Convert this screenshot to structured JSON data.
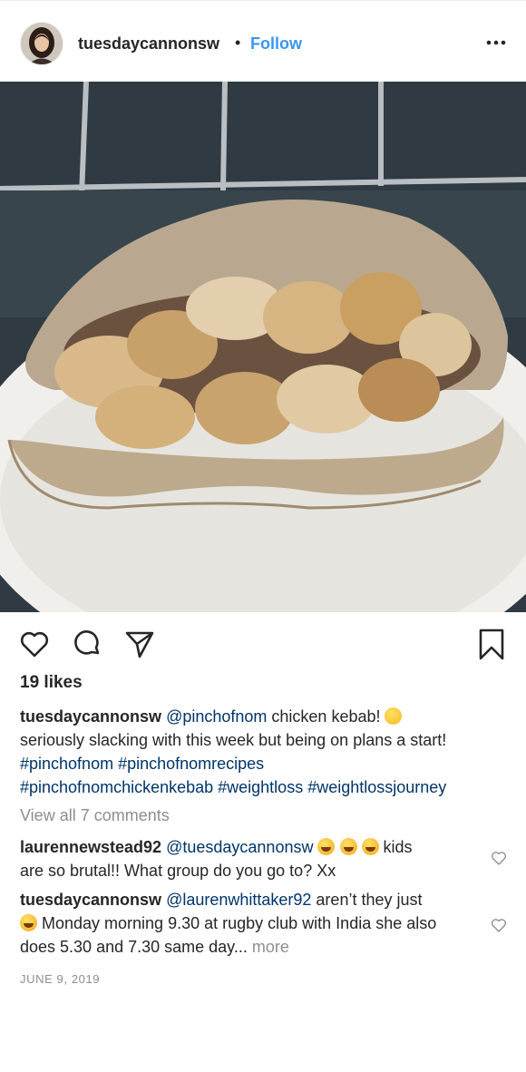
{
  "header": {
    "username": "tuesdaycannonsw",
    "separator": "•",
    "follow_label": "Follow"
  },
  "post": {
    "likes": "19 likes",
    "caption": {
      "username": "tuesdaycannonsw",
      "mention": "@pinchofnom",
      "text1": " chicken kebab! ",
      "text2": "seriously slacking with this week but being on plans a start!",
      "hashtags_line1": "#pinchofnom #pinchofnomrecipes",
      "hashtags_line2": "#pinchofnomchickenkebab #weightloss #weightlossjourney"
    },
    "view_all_comments": "View all 7 comments",
    "comments": [
      {
        "username": "laurennewstead92",
        "mention": "@tuesdaycannonsw",
        "text_after_emoji": " kids",
        "text_line2": "are so brutal!! What group do you go to? Xx"
      },
      {
        "username": "tuesdaycannonsw",
        "mention": "@laurenwhittaker92",
        "text1": " aren’t they just",
        "text2": " Monday morning 9.30 at rugby club with India she also",
        "text3": "does 5.30 and 7.30 same day...",
        "more_label": "more"
      }
    ],
    "date": "JUNE 9, 2019"
  },
  "icons": {
    "more": "more-options-icon",
    "like": "heart-icon",
    "comment": "comment-icon",
    "share": "share-icon",
    "save": "bookmark-icon"
  },
  "colors": {
    "link": "#003569",
    "follow": "#3897f0",
    "muted": "#8e8e8e",
    "text": "#262626"
  }
}
